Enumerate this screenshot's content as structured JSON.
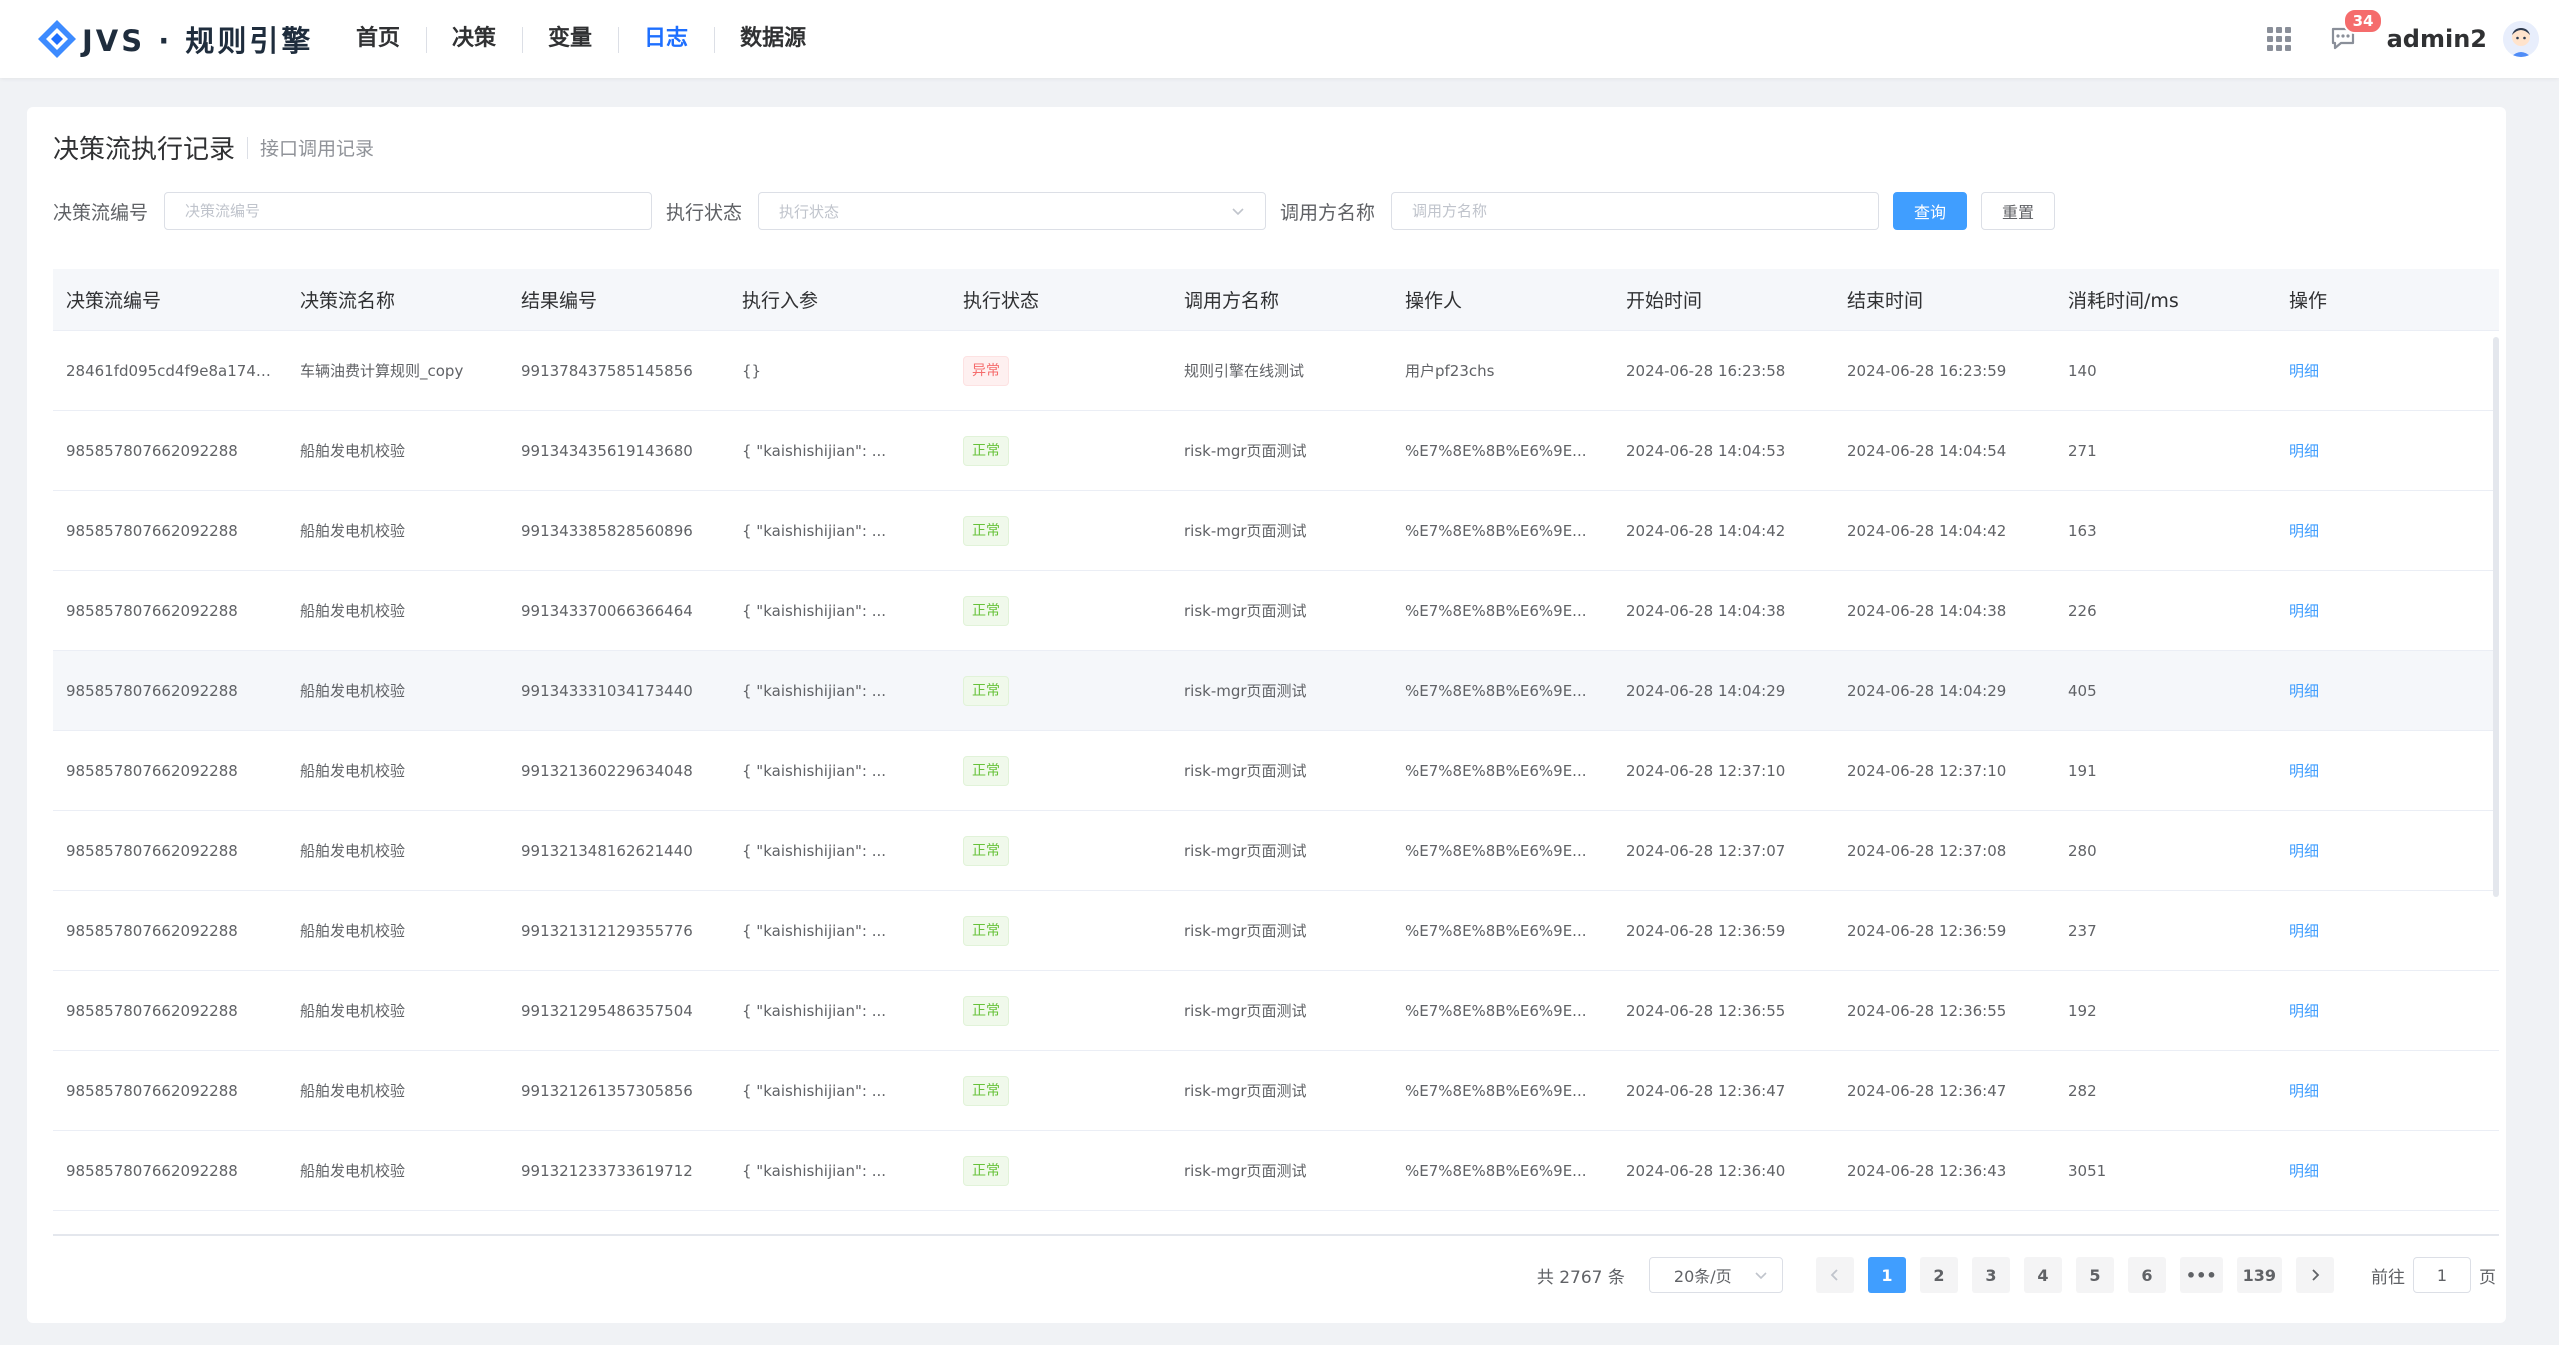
{
  "header": {
    "logo_text": "JVS · 规则引擎",
    "nav": [
      {
        "label": "首页",
        "active": false
      },
      {
        "label": "决策",
        "active": false
      },
      {
        "label": "变量",
        "active": false
      },
      {
        "label": "日志",
        "active": true
      },
      {
        "label": "数据源",
        "active": false
      }
    ],
    "message_count": "34",
    "username": "admin2"
  },
  "page": {
    "title": "决策流执行记录",
    "subtitle": "接口调用记录"
  },
  "filters": {
    "flow_code_label": "决策流编号",
    "flow_code_placeholder": "决策流编号",
    "status_label": "执行状态",
    "status_placeholder": "执行状态",
    "caller_label": "调用方名称",
    "caller_placeholder": "调用方名称",
    "query_button": "查询",
    "reset_button": "重置"
  },
  "table": {
    "columns": [
      "决策流编号",
      "决策流名称",
      "结果编号",
      "执行入参",
      "执行状态",
      "调用方名称",
      "操作人",
      "开始时间",
      "结束时间",
      "消耗时间/ms",
      "操作"
    ],
    "rows": [
      [
        "28461fd095cd4f9e8a1748...",
        "车辆油费计算规则_copy",
        "991378437585145856",
        "{}",
        "异常",
        "规则引擎在线测试",
        "用户pf23chs",
        "2024-06-28 16:23:58",
        "2024-06-28 16:23:59",
        "140",
        "明细"
      ],
      [
        "985857807662092288",
        "船舶发电机校验",
        "991343435619143680",
        "{ \"kaishishijian\": ...",
        "正常",
        "risk-mgr页面测试",
        "%E7%8E%8B%E6%9E...",
        "2024-06-28 14:04:53",
        "2024-06-28 14:04:54",
        "271",
        "明细"
      ],
      [
        "985857807662092288",
        "船舶发电机校验",
        "991343385828560896",
        "{ \"kaishishijian\": ...",
        "正常",
        "risk-mgr页面测试",
        "%E7%8E%8B%E6%9E...",
        "2024-06-28 14:04:42",
        "2024-06-28 14:04:42",
        "163",
        "明细"
      ],
      [
        "985857807662092288",
        "船舶发电机校验",
        "991343370066366464",
        "{ \"kaishishijian\": ...",
        "正常",
        "risk-mgr页面测试",
        "%E7%8E%8B%E6%9E...",
        "2024-06-28 14:04:38",
        "2024-06-28 14:04:38",
        "226",
        "明细"
      ],
      [
        "985857807662092288",
        "船舶发电机校验",
        "991343331034173440",
        "{ \"kaishishijian\": ...",
        "正常",
        "risk-mgr页面测试",
        "%E7%8E%8B%E6%9E...",
        "2024-06-28 14:04:29",
        "2024-06-28 14:04:29",
        "405",
        "明细"
      ],
      [
        "985857807662092288",
        "船舶发电机校验",
        "991321360229634048",
        "{ \"kaishishijian\": ...",
        "正常",
        "risk-mgr页面测试",
        "%E7%8E%8B%E6%9E...",
        "2024-06-28 12:37:10",
        "2024-06-28 12:37:10",
        "191",
        "明细"
      ],
      [
        "985857807662092288",
        "船舶发电机校验",
        "991321348162621440",
        "{ \"kaishishijian\": ...",
        "正常",
        "risk-mgr页面测试",
        "%E7%8E%8B%E6%9E...",
        "2024-06-28 12:37:07",
        "2024-06-28 12:37:08",
        "280",
        "明细"
      ],
      [
        "985857807662092288",
        "船舶发电机校验",
        "991321312129355776",
        "{ \"kaishishijian\": ...",
        "正常",
        "risk-mgr页面测试",
        "%E7%8E%8B%E6%9E...",
        "2024-06-28 12:36:59",
        "2024-06-28 12:36:59",
        "237",
        "明细"
      ],
      [
        "985857807662092288",
        "船舶发电机校验",
        "991321295486357504",
        "{ \"kaishishijian\": ...",
        "正常",
        "risk-mgr页面测试",
        "%E7%8E%8B%E6%9E...",
        "2024-06-28 12:36:55",
        "2024-06-28 12:36:55",
        "192",
        "明细"
      ],
      [
        "985857807662092288",
        "船舶发电机校验",
        "991321261357305856",
        "{ \"kaishishijian\": ...",
        "正常",
        "risk-mgr页面测试",
        "%E7%8E%8B%E6%9E...",
        "2024-06-28 12:36:47",
        "2024-06-28 12:36:47",
        "282",
        "明细"
      ],
      [
        "985857807662092288",
        "船舶发电机校验",
        "991321233733619712",
        "{ \"kaishishijian\": ...",
        "正常",
        "risk-mgr页面测试",
        "%E7%8E%8B%E6%9E...",
        "2024-06-28 12:36:40",
        "2024-06-28 12:36:43",
        "3051",
        "明细"
      ]
    ]
  },
  "pagination": {
    "total_text": "共 2767 条",
    "page_size": "20条/页",
    "pages": [
      "1",
      "2",
      "3",
      "4",
      "5",
      "6",
      "•••",
      "139"
    ],
    "current_page": "1",
    "goto_label": "前往",
    "goto_value": "1",
    "goto_suffix": "页"
  },
  "colors": {
    "primary": "#409eff",
    "nav_active": "#1e6fff",
    "success": "#67c23a",
    "danger": "#f56c6c"
  }
}
